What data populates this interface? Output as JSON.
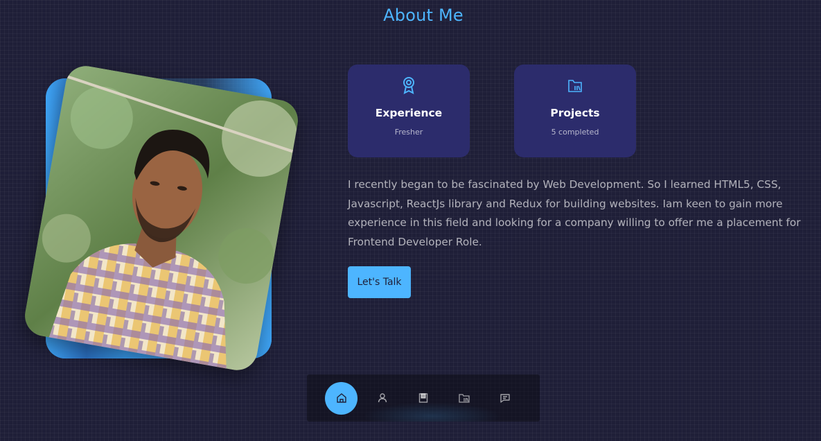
{
  "section": {
    "title": "About Me"
  },
  "cards": [
    {
      "icon": "award-icon",
      "title": "Experience",
      "subtitle": "Fresher"
    },
    {
      "icon": "folder-icon",
      "title": "Projects",
      "subtitle": "5 completed"
    }
  ],
  "about": {
    "text": "I recently began to be fascinated by Web Development. So I learned HTML5, CSS, Javascript, ReactJs library and Redux for building websites. Iam keen to gain more experience in this field and looking for a company willing to offer me a placement for Frontend Developer Role.",
    "button_label": "Let's Talk"
  },
  "nav": {
    "items": [
      {
        "icon": "home-icon",
        "active": true
      },
      {
        "icon": "user-icon",
        "active": false
      },
      {
        "icon": "book-icon",
        "active": false
      },
      {
        "icon": "folder-icon",
        "active": false
      },
      {
        "icon": "message-icon",
        "active": false
      }
    ]
  },
  "colors": {
    "background": "#1f1f38",
    "accent": "#4db5ff",
    "card": "#2c2c6c"
  }
}
